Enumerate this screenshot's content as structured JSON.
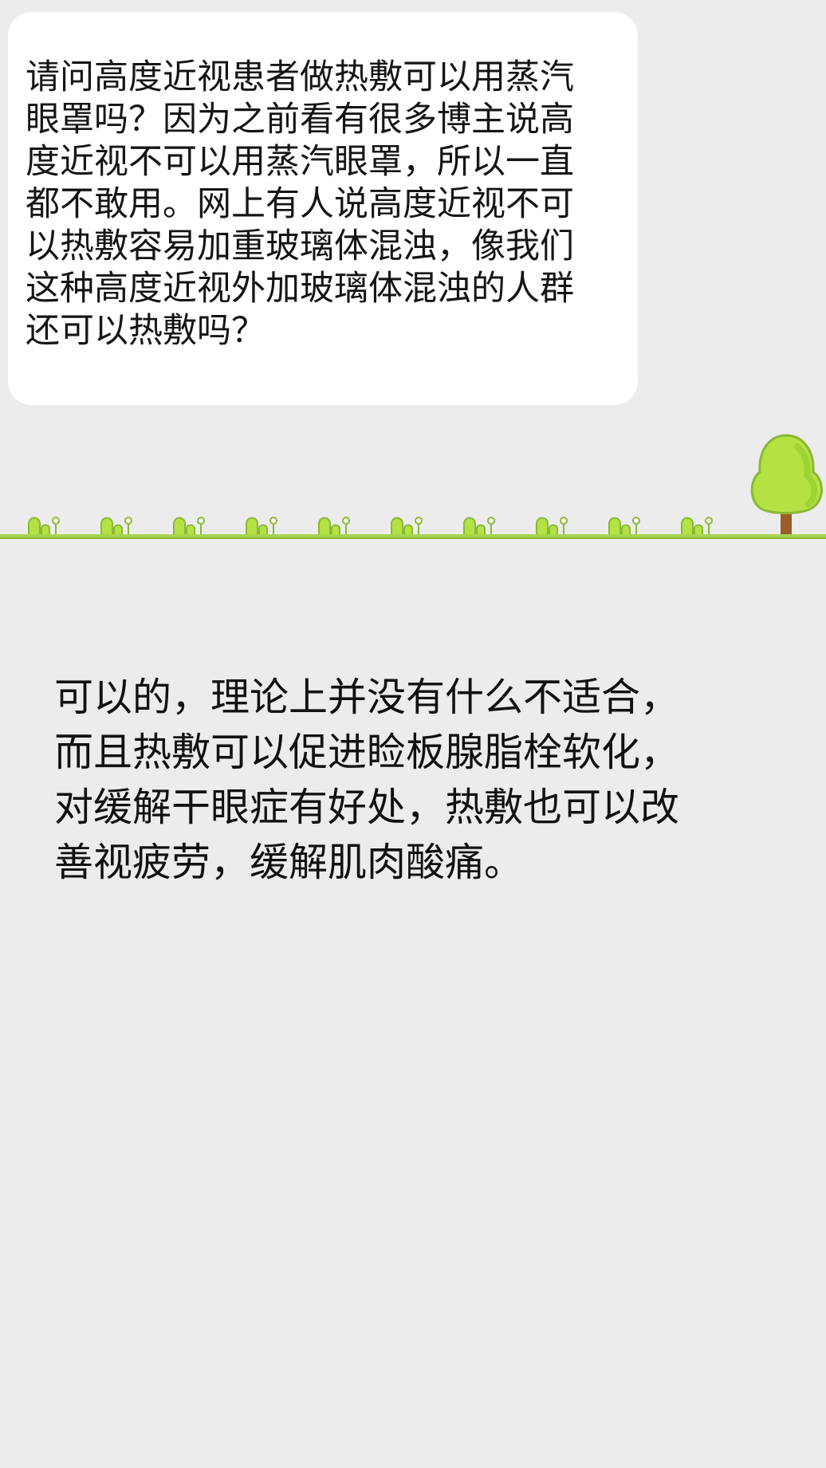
{
  "colors": {
    "background": "#ececec",
    "bubble": "#ffffff",
    "grass": "#a6d64a",
    "ground_line": "#8ab836",
    "tree_leaf": "#b4e244",
    "tree_trunk": "#9c5b2a"
  },
  "question": {
    "lines": [
      "请问高度近视患者做热敷可以用蒸汽",
      "眼罩吗？因为之前看有很多博主说高",
      "度近视不可以用蒸汽眼罩，所以一直",
      "都不敢用。网上有人说高度近视不可",
      "以热敷容易加重玻璃体混浊，像我们",
      "这种高度近视外加玻璃体混浊的人群",
      "还可以热敷吗？"
    ]
  },
  "divider": {
    "icons": [
      "grass-tuft-icon",
      "tree-icon"
    ],
    "tuft_count": 10
  },
  "answer": {
    "lines": [
      "可以的，理论上并没有什么不适合，",
      "而且热敷可以促进睑板腺脂栓软化，",
      "对缓解干眼症有好处，热敷也可以改",
      "善视疲劳，缓解肌肉酸痛。"
    ]
  }
}
